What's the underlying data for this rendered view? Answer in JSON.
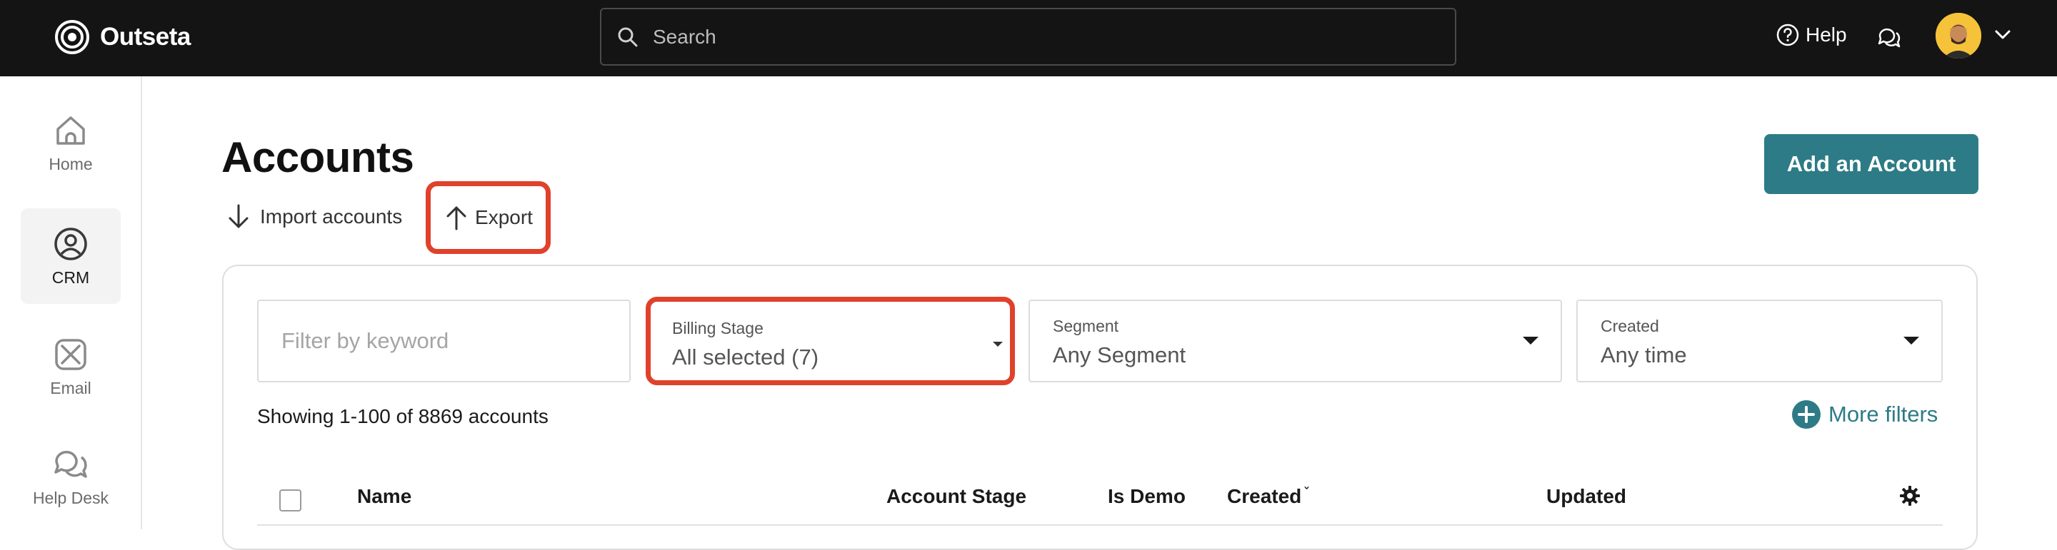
{
  "app": {
    "name": "Outseta"
  },
  "search": {
    "placeholder": "Search"
  },
  "topbar": {
    "help_label": "Help"
  },
  "sidebar": {
    "items": [
      {
        "label": "Home",
        "icon": "home-icon",
        "active": false
      },
      {
        "label": "CRM",
        "icon": "crm-icon",
        "active": true
      },
      {
        "label": "Email",
        "icon": "email-icon",
        "active": false
      },
      {
        "label": "Help Desk",
        "icon": "help-desk-icon",
        "active": false
      }
    ]
  },
  "page": {
    "title": "Accounts",
    "import_label": "Import accounts",
    "export_label": "Export",
    "add_button_label": "Add an Account"
  },
  "filters": {
    "keyword_placeholder": "Filter by keyword",
    "billing_stage": {
      "label": "Billing Stage",
      "value": "All selected (7)"
    },
    "segment": {
      "label": "Segment",
      "value": "Any Segment"
    },
    "created": {
      "label": "Created",
      "value": "Any time"
    },
    "more_filters_label": "More filters"
  },
  "results": {
    "summary": "Showing 1-100 of 8869 accounts"
  },
  "table": {
    "columns": [
      "Name",
      "Account Stage",
      "Is Demo",
      "Created",
      "Updated"
    ]
  },
  "colors": {
    "accent": "#2d7b86",
    "highlight": "#e0412b",
    "topbar": "#141414"
  }
}
